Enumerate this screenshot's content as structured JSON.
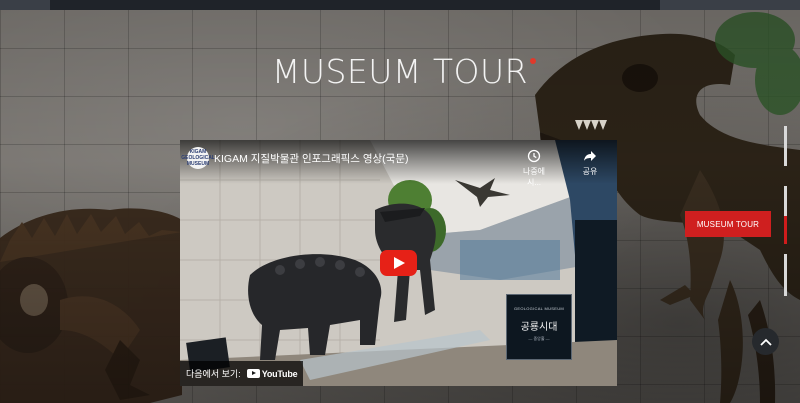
{
  "page": {
    "title": "MUSEUM TOUR",
    "accent_color": "#e0392b"
  },
  "video": {
    "channel_logo_text": "KIGAM GEOLOGICAL MUSEUM",
    "title": "KIGAM 지질박물관 인포그래픽스 영상(국문)",
    "watch_later_label": "나중에 시...",
    "share_label": "공유",
    "watch_on_label": "다음에서 보기:",
    "youtube_label": "YouTube",
    "play_button_color": "#e62117",
    "sign": {
      "kicker": "GEOLOGICAL MUSEUM",
      "title": "공룡시대",
      "subtitle": "— 중앙홀 —"
    }
  },
  "side": {
    "tour_button_label": "MUSEUM TOUR",
    "tour_button_color": "#cf1f1f"
  },
  "icons": {
    "watch_later": "clock-icon",
    "share": "share-arrow-icon",
    "play": "play-icon",
    "youtube": "youtube-icon",
    "scroll_top": "chevron-up-icon"
  }
}
